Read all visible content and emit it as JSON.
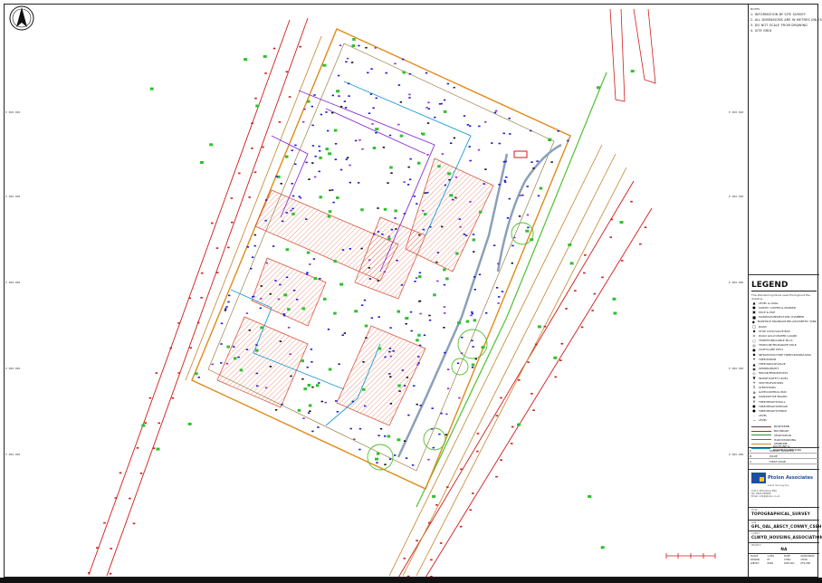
{
  "sheet": {
    "notes_header": "NOTES",
    "notes": [
      "1. INFORMATION BY SITE SURVEY",
      "2. ALL DIMENSIONS ARE IN METRES UNLESS NOTED",
      "3. DO NOT SCALE FROM DRAWING",
      "4. SITE GRID"
    ],
    "grid_ticks_left": [
      "E 000.000",
      "E 000.000",
      "E 000.000",
      "E 000.000",
      "E 000.000"
    ],
    "grid_ticks_right": [
      "E 000.000",
      "E 000.000",
      "E 000.000",
      "E 000.000",
      "E 000.000"
    ],
    "north_label": "NORTH"
  },
  "legend": {
    "title": "LEGEND",
    "description": "The standard symbols used throughout the drawing.",
    "symbols": [
      {
        "glyph": "▲",
        "label": "LEVEL & ANGL"
      },
      {
        "glyph": "●",
        "label": "SURVEY CONTROL MARKER"
      },
      {
        "glyph": "▣",
        "label": "POLE & PILE"
      },
      {
        "glyph": "■",
        "label": "MANHOLE/INSPECTION CHAMBER"
      },
      {
        "glyph": "◆",
        "label": "MANHOLE DRAINAGE BELAISS/SEPTIC TANK"
      },
      {
        "glyph": "□",
        "label": "ROAD"
      },
      {
        "glyph": "▪",
        "label": "STOP COCK/VALVE BOX"
      },
      {
        "glyph": "▫",
        "label": "ROAD GULLY/WATER GUARD"
      },
      {
        "glyph": "○",
        "label": "TELEPHONE/CABLE PILLS"
      },
      {
        "glyph": "◎",
        "label": "TELECOM/TELEGRAPH POLE"
      },
      {
        "glyph": "●",
        "label": "LIGHT/LAMP POST"
      },
      {
        "glyph": "◆",
        "label": "INFRASTRUCTURE TREE/CROWN/LONG"
      },
      {
        "glyph": "✦",
        "label": "TREE/SHRUB"
      },
      {
        "glyph": "▲",
        "label": "TREE/GROUP/VALVE"
      },
      {
        "glyph": "◉",
        "label": "SPRINKLER/PIT"
      },
      {
        "glyph": "◇",
        "label": "HEDGE/FENCE/POSTS"
      },
      {
        "glyph": "▼",
        "label": "INVERT/SOFFIT LEVEL"
      },
      {
        "glyph": "+",
        "label": "SPOT/ELEVATIONS"
      },
      {
        "glyph": "↕",
        "label": "STEP/STAIRS"
      },
      {
        "glyph": "⊕",
        "label": "GATE/CONTROL BOX"
      },
      {
        "glyph": "◈",
        "label": "SIGN/NOTICE BOARD"
      },
      {
        "glyph": "✕",
        "label": "TREE/HEIGHT/WALL"
      },
      {
        "glyph": "●",
        "label": "TREE/HEIGHT/HEDGE"
      },
      {
        "glyph": "●",
        "label": "TREE/HEIGHT/FENCE"
      },
      {
        "glyph": "·",
        "label": "LEVEL"
      },
      {
        "glyph": "−",
        "label": "LEVEL"
      }
    ],
    "lines": [
      {
        "color": "#444444",
        "label": "BASE/KERB"
      },
      {
        "color": "#d21a1a",
        "label": "BOUNDARY"
      },
      {
        "color": "#2e8b3a",
        "label": "VEGETATION"
      },
      {
        "color": "#8a6a2a",
        "label": "HARDSTANDING"
      },
      {
        "color": "#d08a1a",
        "label": "KERBLINE"
      },
      {
        "color": "#1a9ad2",
        "label": "ROOFLINE & PARAPET/OVERHANG"
      }
    ]
  },
  "revisions": [
    {
      "rev": "C",
      "date": "",
      "desc": "SURVEY UPDATED"
    },
    {
      "rev": "B",
      "date": "",
      "desc": "ISSUE"
    },
    {
      "rev": "A",
      "date": "",
      "desc": "FIRST ISSUE"
    }
  ],
  "company": {
    "name": "Ptolon Associates",
    "subtitle": "Land Surveyors",
    "lines": [
      "Unit 4, Enterprise Park",
      "Tel: 0000 000000",
      "Email: info@ptolon.co.uk"
    ]
  },
  "title_fields": {
    "drawing_title_label": "TITLE",
    "drawing_title": "TOPOGRAPHICAL_SURVEY",
    "site_label": "SITE",
    "site": "GPL_OAL_ABSCY_CONWY_CSSH",
    "client_label": "CLIENT",
    "client": "CLWYD_HOUSING_ASSOCIATION",
    "project_label": "PROJECT",
    "project": "NA",
    "scale_label": "SCALE",
    "scale": "1:250",
    "date_label": "DATE",
    "date": "00/00/0000",
    "drawn_label": "DRAWN",
    "drawn": "PT",
    "checked_label": "CHKD",
    "checked": "CHKD",
    "job_label": "JOB NO",
    "job": "0000",
    "dwg_label": "DWG NO",
    "dwg": "PTS-000"
  },
  "colors": {
    "boundary": "#d21a1a",
    "building_hatch": "#d9553a",
    "road": "#8aa0b8",
    "kerb": "#e08a1a",
    "vegetation": "#2ec12e",
    "survey_points": "#1a1ad2",
    "services": "#8a2ad2",
    "fence_blue": "#1a9ad2"
  }
}
